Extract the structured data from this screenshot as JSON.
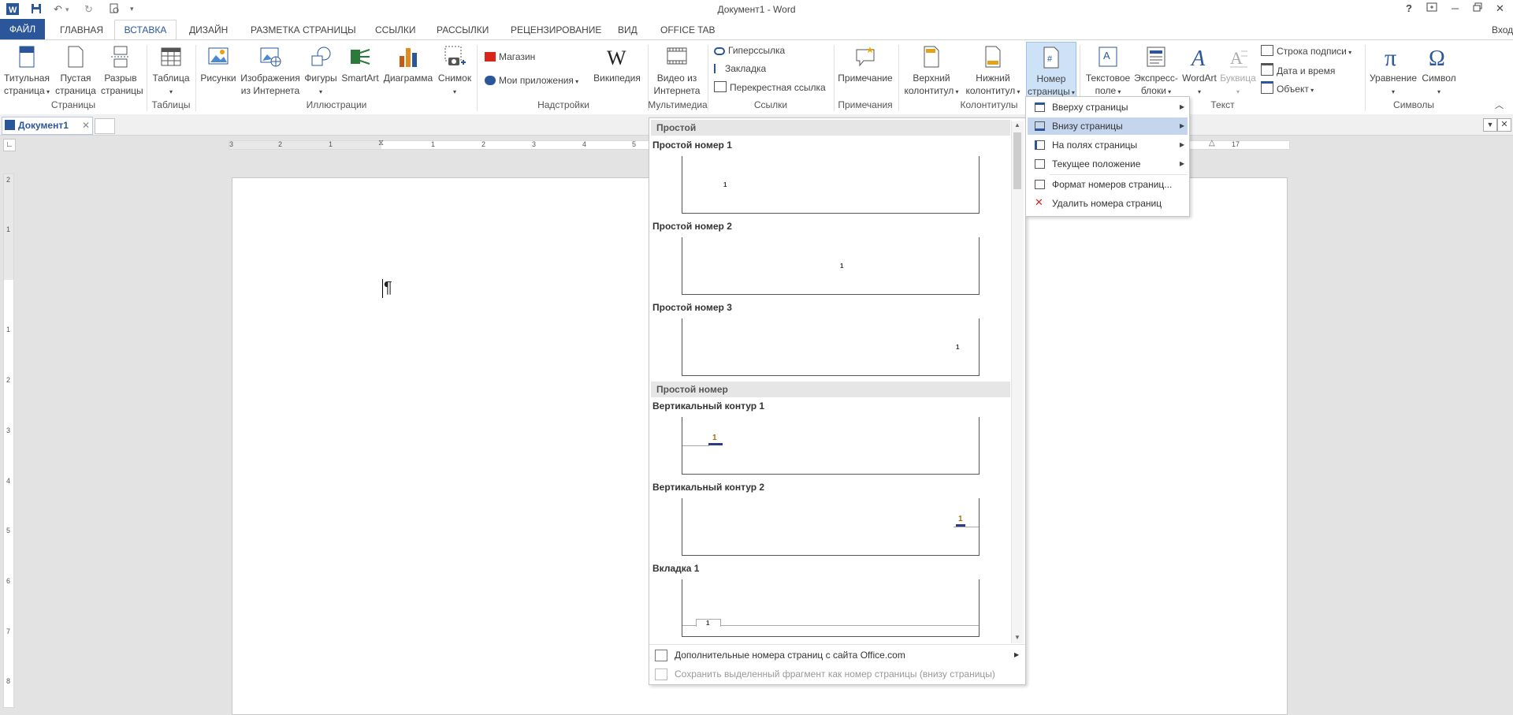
{
  "window": {
    "title": "Документ1 - Word",
    "help": "?",
    "signin": "Вход"
  },
  "tabs": [
    "ФАЙЛ",
    "ГЛАВНАЯ",
    "ВСТАВКА",
    "ДИЗАЙН",
    "РАЗМЕТКА СТРАНИЦЫ",
    "ССЫЛКИ",
    "РАССЫЛКИ",
    "РЕЦЕНЗИРОВАНИЕ",
    "ВИД",
    "OFFICE TAB"
  ],
  "ribbon": {
    "pages": {
      "title_page": [
        "Титульная",
        "страница"
      ],
      "blank_page": [
        "Пустая",
        "страница"
      ],
      "page_break": [
        "Разрыв",
        "страницы"
      ],
      "label": "Страницы"
    },
    "tables": {
      "table": "Таблица",
      "label": "Таблицы"
    },
    "illustrations": {
      "pictures": "Рисунки",
      "online_pictures": [
        "Изображения",
        "из Интернета"
      ],
      "shapes": "Фигуры",
      "smartart": "SmartArt",
      "chart": "Диаграмма",
      "screenshot": "Снимок",
      "label": "Иллюстрации"
    },
    "addins": {
      "store": "Магазин",
      "my_apps": "Мои приложения",
      "wikipedia": "Википедия",
      "label": "Надстройки"
    },
    "media": {
      "online_video": [
        "Видео из",
        "Интернета"
      ],
      "label": "Мультимедиа"
    },
    "links": {
      "hyperlink": "Гиперссылка",
      "bookmark": "Закладка",
      "cross_ref": "Перекрестная ссылка",
      "label": "Ссылки"
    },
    "comments": {
      "comment": "Примечание",
      "label": "Примечания"
    },
    "header_footer": {
      "header": [
        "Верхний",
        "колонтитул"
      ],
      "footer": [
        "Нижний",
        "колонтитул"
      ],
      "page_number": [
        "Номер",
        "страницы"
      ],
      "label": "Колонтитулы"
    },
    "text": {
      "text_box": [
        "Текстовое",
        "поле"
      ],
      "quick_parts": [
        "Экспресс-",
        "блоки"
      ],
      "wordart": "WordArt",
      "dropcap": "Буквица",
      "signature_line": "Строка подписи",
      "date_time": "Дата и время",
      "object": "Объект",
      "label": "Текст"
    },
    "symbols": {
      "equation": "Уравнение",
      "symbol": "Символ",
      "label": "Символы"
    }
  },
  "doc_tab": "Документ1",
  "ruler": {
    "h": [
      "3",
      "2",
      "1",
      "1",
      "2",
      "3",
      "4",
      "5",
      "17"
    ],
    "v": [
      "2",
      "1",
      "1",
      "2",
      "3",
      "4",
      "5",
      "6",
      "7",
      "8"
    ]
  },
  "gallery": {
    "cat1": "Простой",
    "items1": [
      {
        "title": "Простой номер 1",
        "num": "1"
      },
      {
        "title": "Простой номер 2",
        "num": "1"
      },
      {
        "title": "Простой номер 3",
        "num": "1"
      }
    ],
    "cat2": "Простой номер",
    "items2": [
      {
        "title": "Вертикальный контур 1",
        "num": "1"
      },
      {
        "title": "Вертикальный контур 2",
        "num": "1"
      },
      {
        "title": "Вкладка 1",
        "num": "1"
      }
    ],
    "more": "Дополнительные номера страниц с сайта Office.com",
    "save": "Сохранить выделенный фрагмент как номер страницы (внизу страницы)"
  },
  "submenu": [
    "Вверху страницы",
    "Внизу страницы",
    "На полях страницы",
    "Текущее положение",
    "Формат номеров страниц...",
    "Удалить номера страниц"
  ],
  "colors": {
    "accent": "#2b579a",
    "hover": "#c5d5ee",
    "selected": "#cde1f7"
  }
}
